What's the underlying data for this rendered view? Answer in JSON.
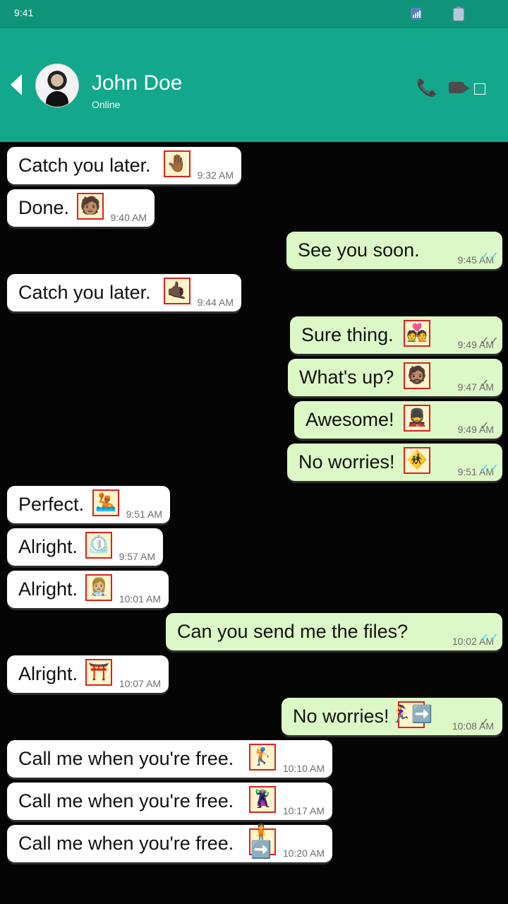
{
  "status_bar": {
    "time": "9:41",
    "signal_icon": "signal-icon",
    "battery_icon": "battery-icon"
  },
  "header": {
    "contact_name": "John Doe",
    "contact_status": "Online",
    "back_icon": "back-arrow-icon",
    "call_icon": "phone-icon",
    "video_icon": "video-camera-icon",
    "menu_icon": "menu-icon"
  },
  "messages": [
    {
      "direction": "incoming",
      "text": "Catch you later.",
      "emoji": "🤚🏾",
      "time": "9:32 AM",
      "status": ""
    },
    {
      "direction": "incoming",
      "text": "Done.",
      "emoji": "🧑🏽",
      "time": "9:40 AM",
      "status": ""
    },
    {
      "direction": "outgoing",
      "text": "See you soon.",
      "emoji": "",
      "time": "9:45 AM",
      "status": "read"
    },
    {
      "direction": "incoming",
      "text": "Catch you later.",
      "emoji": "🤙🏿",
      "time": "9:44 AM",
      "status": ""
    },
    {
      "direction": "outgoing",
      "text": "Sure thing.",
      "emoji": "💑",
      "time": "9:49 AM",
      "status": "delivered"
    },
    {
      "direction": "outgoing",
      "text": "What's up?",
      "emoji": "🧔🏽",
      "time": "9:47 AM",
      "status": "sent"
    },
    {
      "direction": "outgoing",
      "text": "Awesome!",
      "emoji": "💂",
      "time": "9:49 AM",
      "status": "sent"
    },
    {
      "direction": "outgoing",
      "text": "No worries!",
      "emoji": "🚸",
      "time": "9:51 AM",
      "status": "read"
    },
    {
      "direction": "incoming",
      "text": "Perfect.",
      "emoji": "🤽🏾",
      "time": "9:51 AM",
      "status": ""
    },
    {
      "direction": "incoming",
      "text": "Alright.",
      "emoji": "⏲️",
      "time": "9:57 AM",
      "status": ""
    },
    {
      "direction": "incoming",
      "text": "Alright.",
      "emoji": "👩🏼‍⚕️",
      "time": "10:01 AM",
      "status": ""
    },
    {
      "direction": "outgoing",
      "text": "Can you send me the files?",
      "emoji": "",
      "time": "10:02 AM",
      "status": "read"
    },
    {
      "direction": "incoming",
      "text": "Alright.",
      "emoji": "⛩️",
      "time": "10:07 AM",
      "status": ""
    },
    {
      "direction": "outgoing",
      "text": "No worries!",
      "emoji": "🏃‍♀️➡️",
      "time": "10:08 AM",
      "status": "sent"
    },
    {
      "direction": "incoming",
      "text": "Call me when you're free.",
      "emoji": "🏌️",
      "time": "10:10 AM",
      "status": ""
    },
    {
      "direction": "incoming",
      "text": "Call me when you're free.",
      "emoji": "🦹🏼",
      "time": "10:17 AM",
      "status": ""
    },
    {
      "direction": "incoming",
      "text": "Call me when you're free.",
      "emoji": "🧍➡️",
      "time": "10:20 AM",
      "status": ""
    }
  ]
}
